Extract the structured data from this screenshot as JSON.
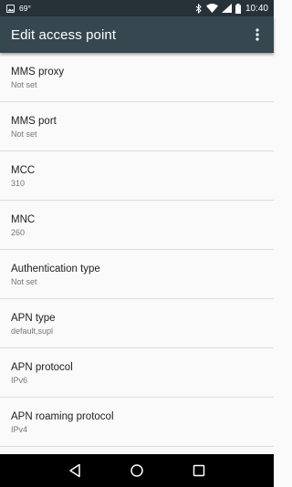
{
  "status_bar": {
    "temperature": "69°",
    "time": "10:40",
    "icons": [
      "image-icon",
      "bluetooth-icon",
      "wifi-icon",
      "signal-icon",
      "battery-icon"
    ]
  },
  "app_bar": {
    "title": "Edit access point",
    "overflow_icon": "more-vert-icon"
  },
  "preferences": [
    {
      "title": "MMS proxy",
      "summary": "Not set"
    },
    {
      "title": "MMS port",
      "summary": "Not set"
    },
    {
      "title": "MCC",
      "summary": "310"
    },
    {
      "title": "MNC",
      "summary": "260"
    },
    {
      "title": "Authentication type",
      "summary": "Not set"
    },
    {
      "title": "APN type",
      "summary": "default,supl"
    },
    {
      "title": "APN protocol",
      "summary": "IPv6"
    },
    {
      "title": "APN roaming protocol",
      "summary": "IPv4"
    }
  ],
  "nav_bar": {
    "icons": [
      "back-icon",
      "home-icon",
      "recents-icon"
    ]
  },
  "colors": {
    "status_bar": "#263238",
    "app_bar": "#37474f",
    "background": "#fafafa",
    "nav_bar": "#000000"
  }
}
